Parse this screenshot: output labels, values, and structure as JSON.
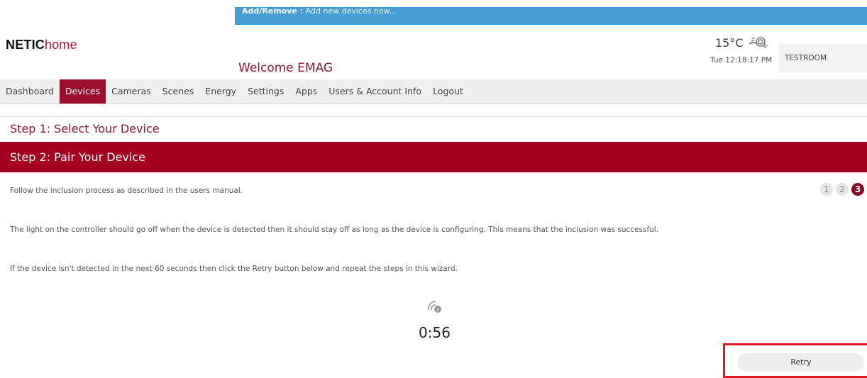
{
  "banner": {
    "title": "Add/Remove :",
    "text": "Add new devices now..."
  },
  "logo": {
    "part1": "NETIC",
    "part2": "home"
  },
  "welcome": "Welcome EMAG",
  "weather": {
    "temperature": "15°C",
    "icon": "wind-weather-icon"
  },
  "clock": "Tue  12:18:17 PM",
  "room_select": {
    "value": "TESTROOM"
  },
  "nav": {
    "items": [
      {
        "label": "Dashboard"
      },
      {
        "label": "Devices",
        "active": true
      },
      {
        "label": "Cameras"
      },
      {
        "label": "Scenes"
      },
      {
        "label": "Energy"
      },
      {
        "label": "Settings"
      },
      {
        "label": "Apps"
      },
      {
        "label": "Users & Account Info"
      },
      {
        "label": "Logout"
      }
    ]
  },
  "steps": {
    "step1": "Step 1: Select Your Device",
    "step2": "Step 2: Pair Your Device"
  },
  "instructions": {
    "p1": "Follow the inclusion process as described in the users manual.",
    "p2": "The light on the controller should go off when the device is detected then it should stay off as long as the device is configuring. This means that the inclusion was successful.",
    "p3": "If the device isn't detected in the next 60 seconds then click the Retry button below and repeat the steps in this wizard."
  },
  "pager": {
    "pages": [
      "1",
      "2",
      "3"
    ],
    "current": 3
  },
  "countdown": "0:56",
  "retry_label": "Retry",
  "colors": {
    "brand": "#a5001f",
    "banner": "#469ed4",
    "highlight": "#e01a24"
  }
}
